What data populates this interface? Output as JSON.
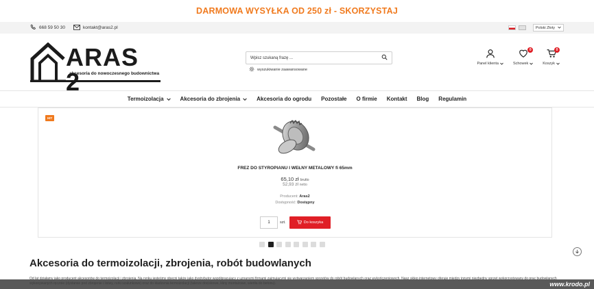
{
  "promo": {
    "text": "DARMOWA WYSYŁKA OD 250 zł - SKORZYSTAJ"
  },
  "topbar": {
    "phone": "668 59 50 30",
    "email": "kontakt@aras2.pl",
    "currency": "Polski Złoty"
  },
  "logo": {
    "brand": "ARAS 2",
    "tagline": "akcesoria do nowoczesnego budownictwa"
  },
  "search": {
    "placeholder": "Wpisz szukaną frazę ...",
    "advanced": "wyszukiwanie zaawansowane"
  },
  "account": {
    "panel": "Panel klienta",
    "wishlist": "Schowek",
    "wishlist_count": "0",
    "cart": "Koszyk",
    "cart_count": "0"
  },
  "nav": {
    "items": [
      {
        "label": "Termoizolacja",
        "dropdown": true
      },
      {
        "label": "Akcesoria do zbrojenia",
        "dropdown": true
      },
      {
        "label": "Akcesoria do ogrodu",
        "dropdown": false
      },
      {
        "label": "Pozostałe",
        "dropdown": false
      },
      {
        "label": "O firmie",
        "dropdown": false
      },
      {
        "label": "Kontakt",
        "dropdown": false
      },
      {
        "label": "Blog",
        "dropdown": false
      },
      {
        "label": "Regulamin",
        "dropdown": false
      }
    ]
  },
  "product": {
    "badge": "HIT",
    "name": "FREZ DO STYROPIANU I WEŁNY METALOWY fi 65mm",
    "price_gross": "65,10 zł",
    "gross_label": "brutto",
    "price_net": "52,93 zł",
    "net_label": "netto",
    "producer_label": "Producent:",
    "producer": "Aras2",
    "availability_label": "Dostępność:",
    "availability": "Dostępny",
    "qty": "1",
    "unit": "szt.",
    "add_to_cart": "Do koszyka"
  },
  "slider": {
    "dots": 8,
    "active": 1
  },
  "section": {
    "title": "Akcesoria do termoizolacji, zbrojenia, robót budowlanych",
    "text": "Od lat działamy jako producent akcesoriów do termoizolacji i zbrojenia. Na rynku jesteśmy obecni także jako dystrybutor współpracujący z uznanymi firmami zajmującymi się wytwarzaniem sprzętów do robót budowlanych oraz wykończeniowych. Nasz sklep internetowy oferuje między innymi niezbędny sprzęt wykorzystywany do prac budowlanych wykonywanych ręcznie (dystanse pod zbrojenie i listwy, rurki szalunkowe) oraz do kładzenia termoizolacji (talerze dociskowe, kliny montażowe, wiertła do betonu)."
  },
  "watermark": "www.krodo.pl",
  "colors": {
    "accent": "#f07a1e",
    "cta": "#e01f26",
    "text": "#222222"
  }
}
